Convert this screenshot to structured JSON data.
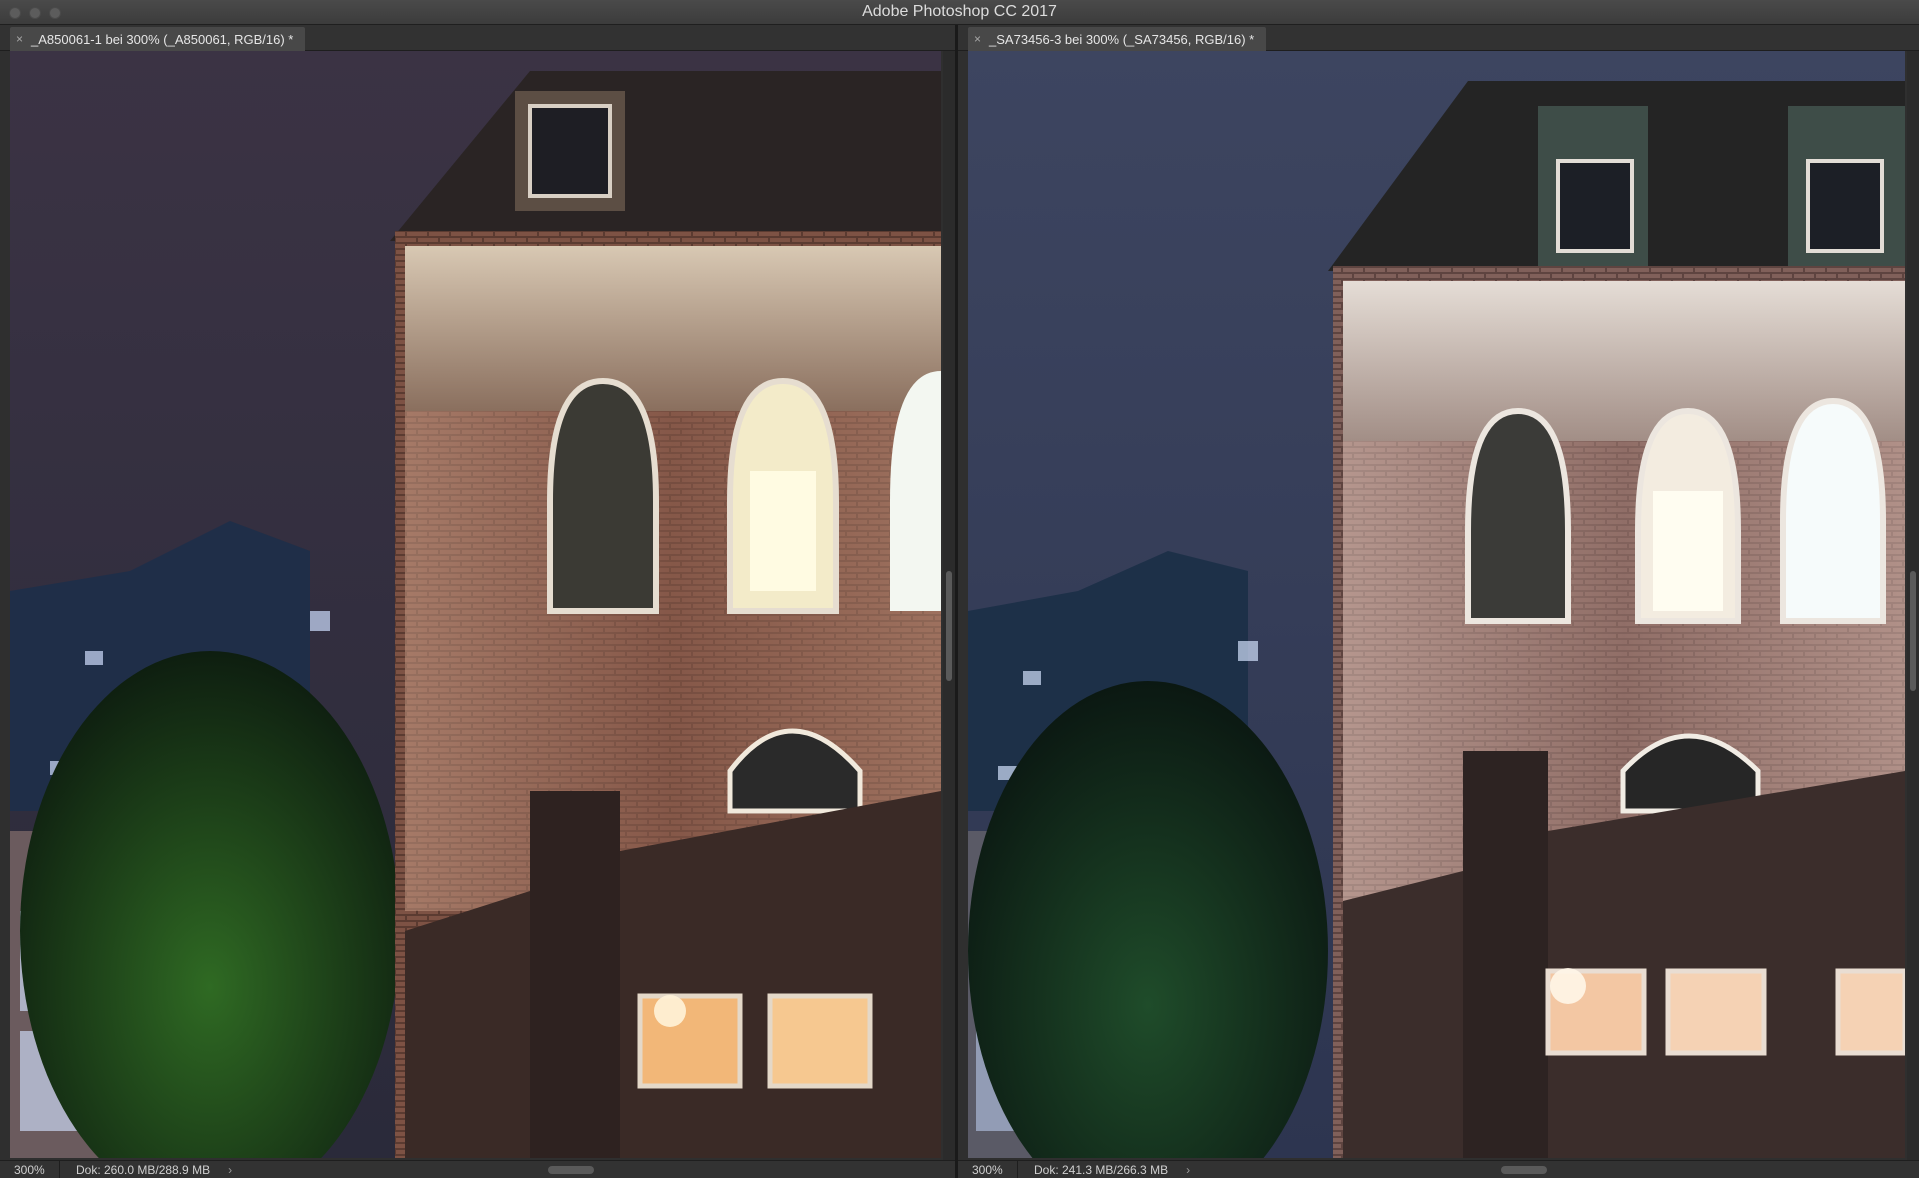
{
  "app": {
    "title": "Adobe Photoshop CC 2017"
  },
  "documents": [
    {
      "tab_label": "_A850061-1 bei 300% (_A850061, RGB/16) *",
      "zoom": "300%",
      "doc_info": "Dok: 260.0 MB/288.9 MB"
    },
    {
      "tab_label": "_SA73456-3 bei 300% (_SA73456, RGB/16) *",
      "zoom": "300%",
      "doc_info": "Dok: 241.3 MB/266.3 MB"
    }
  ],
  "icons": {
    "close": "close-icon",
    "arrow": "chevron-right-icon"
  },
  "glyphs": {
    "close": "×",
    "arrow": "›"
  },
  "colors": {
    "sky_left": "#3a3444",
    "sky_right": "#3a4058",
    "brick": "#6b4638",
    "facade_lit": "#c9b6a2",
    "window_glow": "#f3e7c3"
  }
}
